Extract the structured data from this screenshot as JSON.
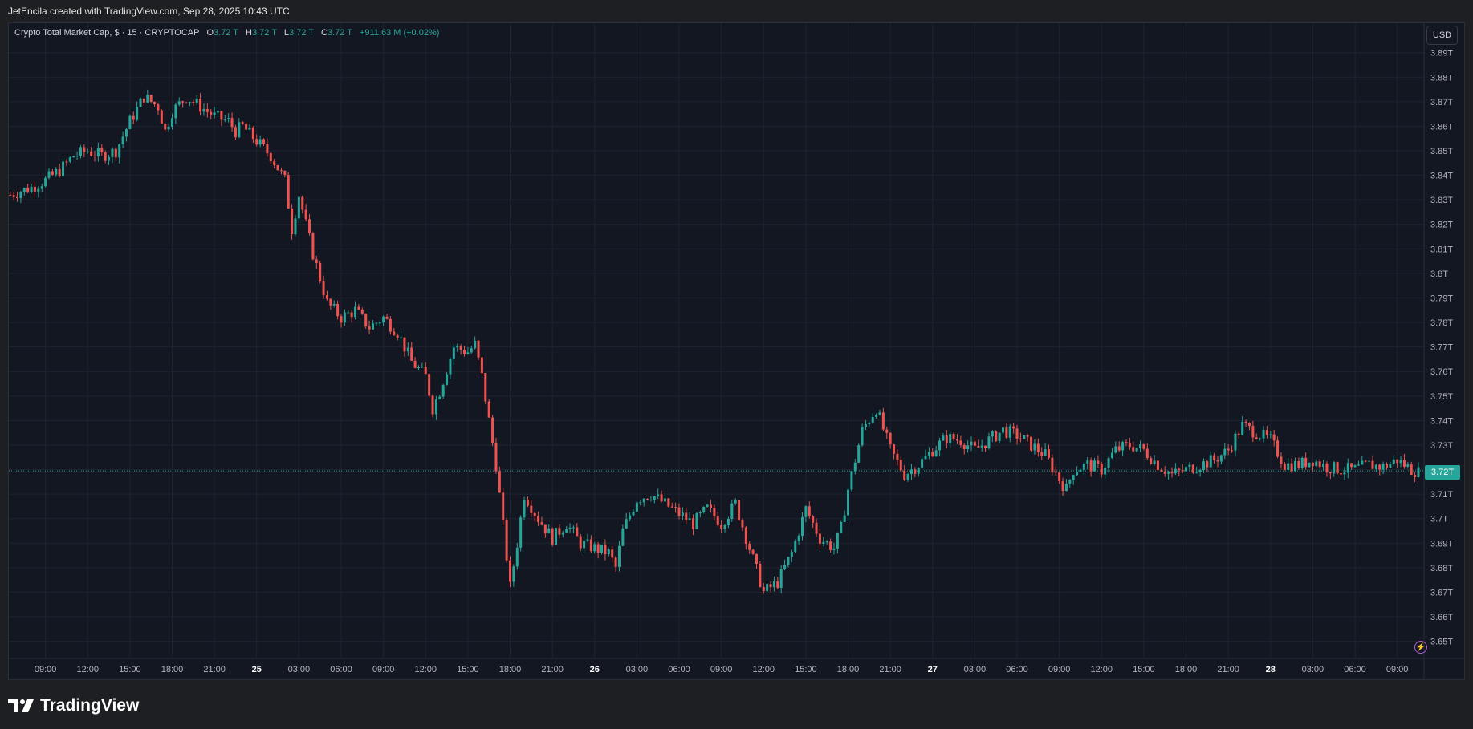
{
  "header": {
    "caption": "JetEncila created with TradingView.com, Sep 28, 2025 10:43 UTC"
  },
  "legend": {
    "symbol": "Crypto Total Market Cap, $ · 15 · CRYPTOCAP",
    "o_label": "O",
    "o_value": "3.72 T",
    "h_label": "H",
    "h_value": "3.72 T",
    "l_label": "L",
    "l_value": "3.72 T",
    "c_label": "C",
    "c_value": "3.72 T",
    "change": "+911.63 M (+0.02%)"
  },
  "currency_button": "USD",
  "last_price_label": "3.72T",
  "brand": {
    "name": "TradingView",
    "icon": "tradingview-logo-icon"
  },
  "colors": {
    "up": "#26a69a",
    "down": "#ef5350",
    "background": "#131722",
    "grid": "#1f2330"
  },
  "chart_data": {
    "type": "candlestick",
    "ylim": [
      3.643,
      3.902
    ],
    "y_ticks": [
      "3.89T",
      "3.88T",
      "3.87T",
      "3.86T",
      "3.85T",
      "3.84T",
      "3.83T",
      "3.82T",
      "3.81T",
      "3.8T",
      "3.79T",
      "3.78T",
      "3.77T",
      "3.76T",
      "3.75T",
      "3.74T",
      "3.73T",
      "3.72T",
      "3.71T",
      "3.7T",
      "3.69T",
      "3.68T",
      "3.67T",
      "3.66T",
      "3.65T"
    ],
    "y_tick_values": [
      3.89,
      3.88,
      3.87,
      3.86,
      3.85,
      3.84,
      3.83,
      3.82,
      3.81,
      3.8,
      3.79,
      3.78,
      3.77,
      3.76,
      3.75,
      3.74,
      3.73,
      3.72,
      3.71,
      3.7,
      3.69,
      3.68,
      3.67,
      3.66,
      3.65
    ],
    "x_ticks": [
      "09:00",
      "12:00",
      "15:00",
      "18:00",
      "21:00",
      "25",
      "03:00",
      "06:00",
      "09:00",
      "12:00",
      "15:00",
      "18:00",
      "21:00",
      "26",
      "03:00",
      "06:00",
      "09:00",
      "12:00",
      "15:00",
      "18:00",
      "21:00",
      "27",
      "03:00",
      "06:00",
      "09:00",
      "12:00",
      "15:00",
      "18:00",
      "21:00",
      "28",
      "03:00",
      "06:00",
      "09:00"
    ],
    "bold_x_ticks": [
      "25",
      "26",
      "27",
      "28"
    ],
    "x_tick_hours": [
      9,
      12,
      15,
      18,
      21,
      24,
      27,
      30,
      33,
      36,
      39,
      42,
      45,
      48,
      51,
      54,
      57,
      60,
      63,
      66,
      69,
      72,
      75,
      78,
      81,
      84,
      87,
      90,
      93,
      96,
      99,
      102,
      105
    ],
    "x_range_hours": [
      6.4,
      106.9
    ],
    "last_price": 3.7195,
    "close_path": [
      [
        6.5,
        3.832
      ],
      [
        8,
        3.835
      ],
      [
        9,
        3.838
      ],
      [
        10,
        3.842
      ],
      [
        11,
        3.848
      ],
      [
        12,
        3.85
      ],
      [
        13,
        3.848
      ],
      [
        14,
        3.85
      ],
      [
        15,
        3.862
      ],
      [
        16,
        3.872
      ],
      [
        17,
        3.868
      ],
      [
        17.5,
        3.858
      ],
      [
        18,
        3.866
      ],
      [
        19,
        3.872
      ],
      [
        20,
        3.868
      ],
      [
        21,
        3.864
      ],
      [
        22,
        3.862
      ],
      [
        22.5,
        3.858
      ],
      [
        23,
        3.86
      ],
      [
        24,
        3.854
      ],
      [
        25,
        3.848
      ],
      [
        26,
        3.838
      ],
      [
        26.5,
        3.818
      ],
      [
        27,
        3.832
      ],
      [
        28,
        3.808
      ],
      [
        29,
        3.788
      ],
      [
        30,
        3.782
      ],
      [
        31,
        3.785
      ],
      [
        32,
        3.778
      ],
      [
        33,
        3.782
      ],
      [
        34,
        3.776
      ],
      [
        35,
        3.764
      ],
      [
        36,
        3.758
      ],
      [
        36.5,
        3.745
      ],
      [
        37,
        3.752
      ],
      [
        38,
        3.77
      ],
      [
        39,
        3.768
      ],
      [
        39.5,
        3.771
      ],
      [
        40,
        3.758
      ],
      [
        41,
        3.722
      ],
      [
        42,
        3.672
      ],
      [
        42.5,
        3.69
      ],
      [
        43,
        3.71
      ],
      [
        44,
        3.7
      ],
      [
        45,
        3.692
      ],
      [
        46,
        3.698
      ],
      [
        47,
        3.69
      ],
      [
        48,
        3.688
      ],
      [
        49,
        3.686
      ],
      [
        49.5,
        3.68
      ],
      [
        50,
        3.695
      ],
      [
        51,
        3.708
      ],
      [
        52,
        3.71
      ],
      [
        53,
        3.706
      ],
      [
        54,
        3.702
      ],
      [
        55,
        3.698
      ],
      [
        56,
        3.704
      ],
      [
        57,
        3.698
      ],
      [
        58,
        3.706
      ],
      [
        59,
        3.688
      ],
      [
        60,
        3.67
      ],
      [
        61,
        3.674
      ],
      [
        62,
        3.686
      ],
      [
        63,
        3.704
      ],
      [
        64,
        3.692
      ],
      [
        65,
        3.688
      ],
      [
        65.5,
        3.696
      ],
      [
        66,
        3.712
      ],
      [
        67,
        3.736
      ],
      [
        68,
        3.745
      ],
      [
        69,
        3.728
      ],
      [
        70,
        3.718
      ],
      [
        71,
        3.722
      ],
      [
        72,
        3.728
      ],
      [
        73,
        3.733
      ],
      [
        74,
        3.732
      ],
      [
        75,
        3.728
      ],
      [
        76,
        3.732
      ],
      [
        77,
        3.736
      ],
      [
        78,
        3.734
      ],
      [
        79,
        3.73
      ],
      [
        80,
        3.726
      ],
      [
        81,
        3.716
      ],
      [
        81.5,
        3.712
      ],
      [
        82,
        3.72
      ],
      [
        83,
        3.722
      ],
      [
        84,
        3.72
      ],
      [
        85,
        3.728
      ],
      [
        86,
        3.73
      ],
      [
        87,
        3.728
      ],
      [
        88,
        3.722
      ],
      [
        89,
        3.718
      ],
      [
        90,
        3.72
      ],
      [
        91,
        3.722
      ],
      [
        92,
        3.724
      ],
      [
        93,
        3.728
      ],
      [
        94,
        3.738
      ],
      [
        95,
        3.735
      ],
      [
        96,
        3.732
      ],
      [
        97,
        3.722
      ],
      [
        98,
        3.722
      ],
      [
        99,
        3.724
      ],
      [
        100,
        3.721
      ],
      [
        101,
        3.72
      ],
      [
        102,
        3.72
      ],
      [
        103,
        3.722
      ],
      [
        104,
        3.721
      ],
      [
        105,
        3.724
      ],
      [
        106,
        3.72
      ],
      [
        106.5,
        3.719
      ]
    ]
  }
}
